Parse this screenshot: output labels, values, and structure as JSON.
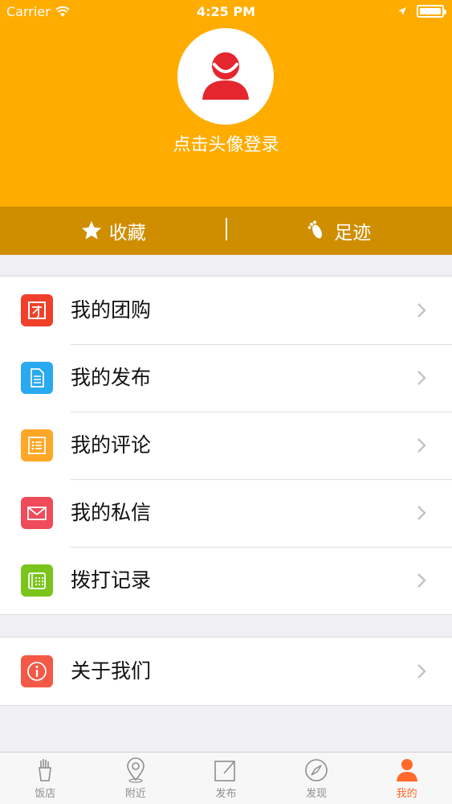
{
  "status_bar": {
    "carrier": "Carrier",
    "time": "4:25 PM"
  },
  "header": {
    "login_text": "点击头像登录"
  },
  "fav_bar": {
    "favorites": "收藏",
    "footprints": "足迹"
  },
  "menu": [
    {
      "label": "我的团购",
      "icon": "group-buy-icon",
      "color": "#f0402a"
    },
    {
      "label": "我的发布",
      "icon": "document-icon",
      "color": "#29a9f0"
    },
    {
      "label": "我的评论",
      "icon": "list-icon",
      "color": "#ffa726"
    },
    {
      "label": "我的私信",
      "icon": "mail-icon",
      "color": "#ef4b5a"
    },
    {
      "label": "拨打记录",
      "icon": "phone-icon",
      "color": "#7ac41c"
    }
  ],
  "about": {
    "label": "关于我们",
    "icon": "info-icon",
    "color": "#f25a47"
  },
  "tabbar": {
    "items": [
      {
        "label": "饭店",
        "icon": "fries-icon"
      },
      {
        "label": "附近",
        "icon": "location-pin-icon"
      },
      {
        "label": "发布",
        "icon": "compose-icon"
      },
      {
        "label": "发现",
        "icon": "compass-icon"
      },
      {
        "label": "我的",
        "icon": "user-icon"
      }
    ],
    "active_index": 4
  },
  "colors": {
    "header": "#ffac00",
    "header_dark": "#cf8e00",
    "accent": "#ff6a2a"
  }
}
